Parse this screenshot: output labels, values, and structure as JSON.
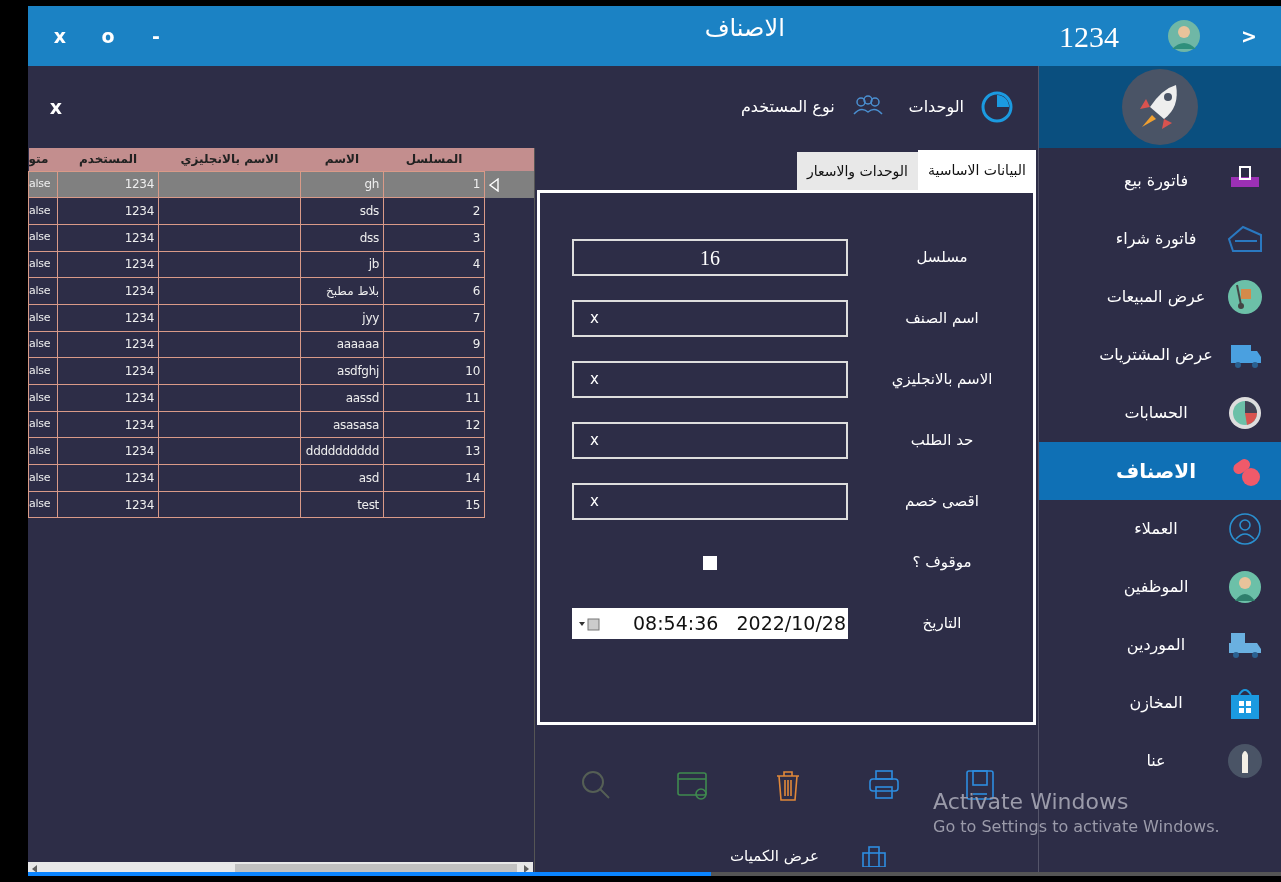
{
  "window": {
    "controls": [
      "-",
      "o",
      "x"
    ],
    "title": "الاصناف",
    "user_code": "1234",
    "back": ">"
  },
  "toolbar": {
    "items": [
      {
        "label": "الوحدات"
      },
      {
        "label": "نوع المستخدم"
      }
    ],
    "close": "x"
  },
  "sidebar": {
    "items": [
      {
        "label": "فاتورة بيع",
        "selected": false
      },
      {
        "label": "فاتورة شراء",
        "selected": false
      },
      {
        "label": "عرض المبيعات",
        "selected": false
      },
      {
        "label": "عرض المشتريات",
        "selected": false
      },
      {
        "label": "الحسابات",
        "selected": false
      },
      {
        "label": "الاصناف",
        "selected": true
      },
      {
        "label": "العملاء",
        "selected": false
      },
      {
        "label": "الموظفين",
        "selected": false
      },
      {
        "label": "الموردين",
        "selected": false
      },
      {
        "label": "المخازن",
        "selected": false
      },
      {
        "label": "عنا",
        "selected": false
      }
    ]
  },
  "grid": {
    "columns": [
      "المسلسل",
      "الاسم",
      "الاسم بالانجليزي",
      "المستخدم",
      "متو"
    ],
    "rows": [
      {
        "serial": "1",
        "name": "gh",
        "user": "1234",
        "column_5": "alse",
        "selected": true
      },
      {
        "serial": "2",
        "name": "sds",
        "user": "1234",
        "column_5": "alse",
        "selected": false
      },
      {
        "serial": "3",
        "name": "dss",
        "user": "1234",
        "column_5": "alse",
        "selected": false
      },
      {
        "serial": "4",
        "name": "jb",
        "user": "1234",
        "column_5": "alse",
        "selected": false
      },
      {
        "serial": "6",
        "name": "بلاط مطبخ",
        "user": "1234",
        "column_5": "alse",
        "selected": false
      },
      {
        "serial": "7",
        "name": "jyy",
        "user": "1234",
        "column_5": "alse",
        "selected": false
      },
      {
        "serial": "9",
        "name": "aaaaaa",
        "user": "1234",
        "column_5": "alse",
        "selected": false
      },
      {
        "serial": "10",
        "name": "asdfghj",
        "user": "1234",
        "column_5": "alse",
        "selected": false
      },
      {
        "serial": "11",
        "name": "aassd",
        "user": "1234",
        "column_5": "alse",
        "selected": false
      },
      {
        "serial": "12",
        "name": "asasasa",
        "user": "1234",
        "column_5": "alse",
        "selected": false
      },
      {
        "serial": "13",
        "name": "dddddddddd",
        "user": "1234",
        "column_5": "alse",
        "selected": false
      },
      {
        "serial": "14",
        "name": "asd",
        "user": "1234",
        "column_5": "alse",
        "selected": false
      },
      {
        "serial": "15",
        "name": "test",
        "user": "1234",
        "column_5": "alse",
        "selected": false
      }
    ]
  },
  "form": {
    "tabs": [
      {
        "label": "البيانات الاساسية",
        "selected": true
      },
      {
        "label": "الوحدات والاسعار",
        "selected": false
      }
    ],
    "fields": [
      {
        "kind": "number",
        "label": "مسلسل",
        "value": "16"
      },
      {
        "kind": "text",
        "label": "اسم الصنف",
        "value": "x"
      },
      {
        "kind": "text",
        "label": "الاسم بالانجليزي",
        "value": "x"
      },
      {
        "kind": "text",
        "label": "حد الطلب",
        "value": "x"
      },
      {
        "kind": "text",
        "label": "اقصى خصم",
        "value": "x"
      },
      {
        "kind": "checkbox",
        "label": "موقوف ؟",
        "checked": false
      },
      {
        "kind": "datetime",
        "label": "التاريخ",
        "date": "2022/10/28",
        "time": "08:54:36"
      }
    ]
  },
  "actions": {
    "quantities_label": "عرض الكميات"
  },
  "os_notice": {
    "title": "Activate Windows",
    "subtitle": "Go to Settings to activate Windows."
  },
  "player": {
    "level": 0.555
  }
}
